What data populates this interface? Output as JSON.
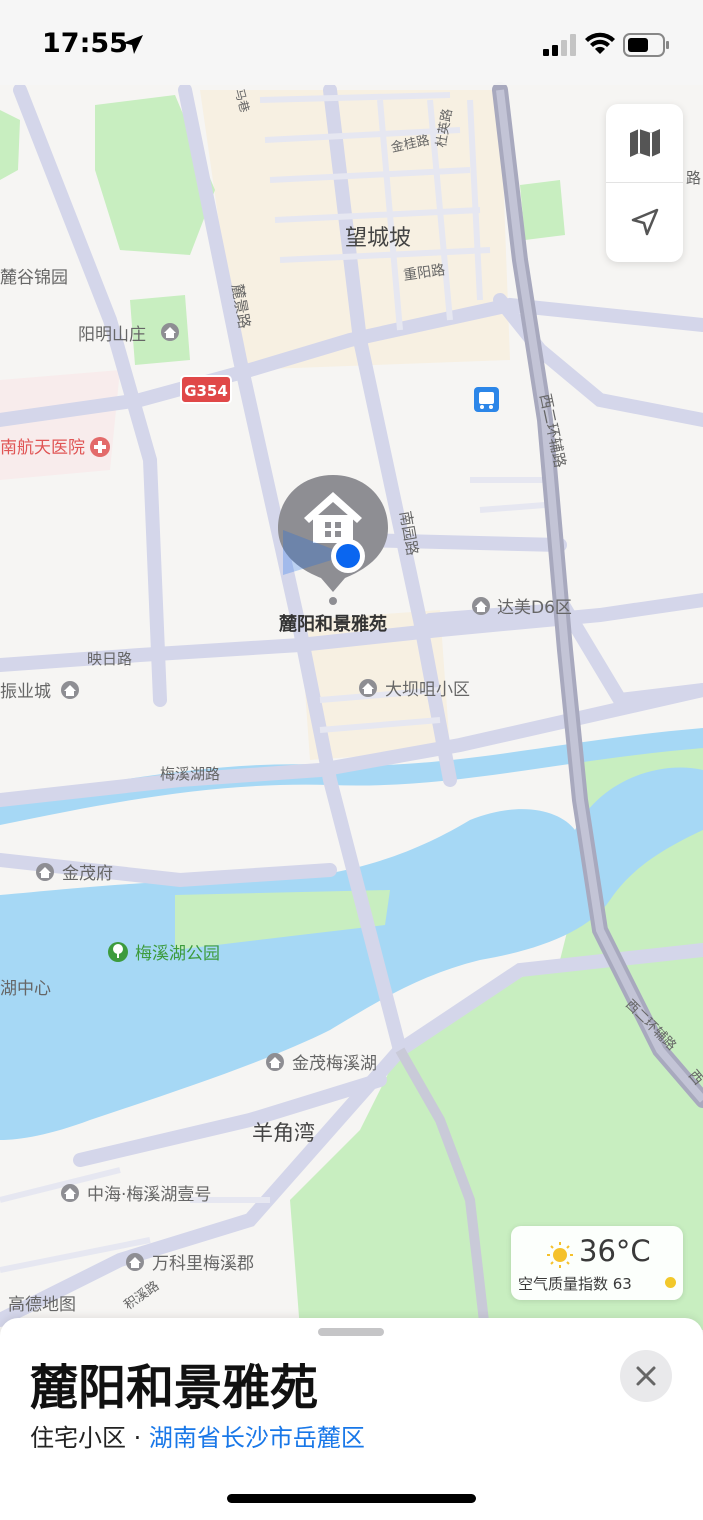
{
  "status_bar": {
    "time": "17:55"
  },
  "map_labels": {
    "wangchengpo": "望城坡",
    "jinguilu": "金桂路",
    "duyinglu": "杜英路",
    "chongyanglu": "重阳路",
    "lujinglu": "麓景路",
    "luguyuan": "麓谷锦园",
    "yangmingshanzhuang": "阳明山庄",
    "g354": "G354",
    "hospital": "南航天医院",
    "xierhuan": "西二环辅路",
    "nanyuanlu": "南园路",
    "dameid6": "达美D6区",
    "yingrilu": "映日路",
    "zhenyecheng": "振业城",
    "dabaxiaoqu": "大坝咀小区",
    "meixihulu": "梅溪湖路",
    "jinmaofu": "金茂府",
    "meixihupark": "梅溪湖公园",
    "huzhongxin": "湖中心",
    "jinmaomeixihu": "金茂梅溪湖",
    "yangjiaowan": "羊角湾",
    "zhonghai": "中海·梅溪湖壹号",
    "wankeli": "万科里梅溪郡",
    "jixilu": "积溪路",
    "gaode": "高德地图",
    "xierhuan2": "西二环辅路",
    "malu": "马巷",
    "lu_right": "路",
    "xi_right": "西",
    "pin_label": "麓阳和景雅苑"
  },
  "weather": {
    "temperature": "36°C",
    "aqi_text": "空气质量指数 63",
    "icon": "sun-icon"
  },
  "sheet": {
    "title": "麓阳和景雅苑",
    "category": "住宅小区",
    "separator": " · ",
    "region": "湖南省长沙市岳麓区"
  },
  "colors": {
    "water": "#a6d8f5",
    "park": "#c8eec0",
    "road": "#d4d6ea",
    "highway": "#a8a9be",
    "accent": "#1877e8",
    "user_dot": "#0a66f0"
  }
}
